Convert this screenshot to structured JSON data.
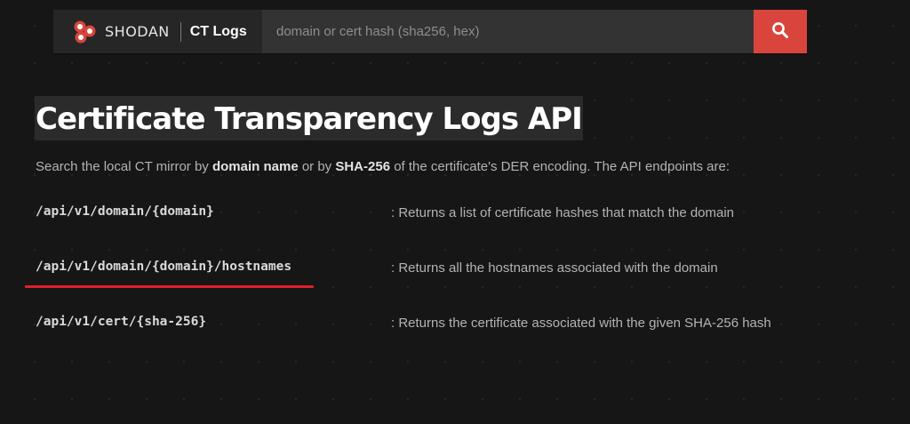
{
  "header": {
    "brand_name": "SHODAN",
    "product_name": "CT Logs",
    "search_placeholder": "domain or cert hash (sha256, hex)",
    "search_value": "",
    "search_button_icon": "search-icon",
    "accent_color": "#d9453c"
  },
  "main": {
    "title": "Certificate Transparency Logs API",
    "intro": {
      "part1": "Search the local CT mirror by ",
      "bold1": "domain name",
      "part2": " or by ",
      "bold2": "SHA-256",
      "part3": " of the certificate's DER encoding. The API endpoints are:"
    },
    "endpoints": [
      {
        "path": "/api/v1/domain/{domain}",
        "description": ": Returns a list of certificate hashes that match the domain"
      },
      {
        "path": "/api/v1/domain/{domain}/hostnames",
        "description": ": Returns all the hostnames associated with the domain"
      },
      {
        "path": "/api/v1/cert/{sha-256}",
        "description": ": Returns the certificate associated with the given SHA-256 hash"
      }
    ],
    "highlight_color": "#e0202a"
  }
}
